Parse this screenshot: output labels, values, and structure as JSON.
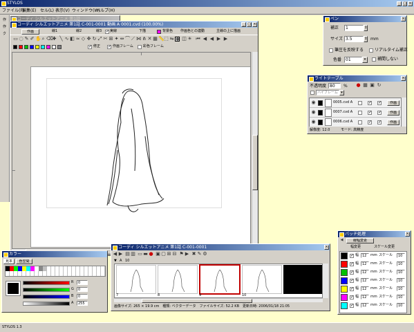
{
  "app": {
    "title": "STYLOS",
    "menu": [
      "ファイル(F)",
      "編集(E)",
      "セル(L)",
      "表示(V)",
      "ウィンドウ(W)",
      "ヘルプ(H)"
    ],
    "status": "STYLOS 1.3"
  },
  "bg_doc": {
    "title": "コーディ シルエットアニメ 第1話"
  },
  "doc": {
    "title": "コーディ シルエットアニメ 第1話 C-001-0001 動画 A 0001.cvd (100.00%)",
    "tool_row1": [
      "作画",
      "線1",
      "線2",
      "線3",
      "実線",
      "下描",
      "背景色",
      "作画色との連動",
      "主線の上に描画"
    ],
    "tool_row2": [
      "修正",
      "作画フレーム",
      "彩色フレーム"
    ],
    "colors": [
      "#000000",
      "#ff0000",
      "#00c000",
      "#0000ff",
      "#ffff00",
      "#00ffff",
      "#ff00ff",
      "#ffffff",
      "#808080"
    ]
  },
  "pen": {
    "title": "ペン",
    "hosei_label": "補正",
    "hosei_value": "1",
    "size_label": "サイズ",
    "size_value": "3.5",
    "size_unit": "mm",
    "pressure_label": "筆圧を反映する",
    "realtime_label": "リアルタイム補正",
    "color_label": "色番",
    "color_value": "01",
    "antialias_label": "補間しない"
  },
  "light": {
    "title": "ライトテーブル",
    "opacity_label": "不透明度",
    "opacity_value": "80",
    "opacity_unit": "%",
    "dropdown": "ハイフレーム",
    "rows": [
      {
        "name": "0005.cvd A",
        "tag": "作画"
      },
      {
        "name": "0007.cvd A",
        "tag": "作画"
      },
      {
        "name": "0006.cvd A",
        "tag": "作画"
      }
    ],
    "footer_res": "解像度: 12.0",
    "footer_mode": "モード: 高精度"
  },
  "color_win": {
    "title": "カラー",
    "tabs": [
      "見本",
      "色空間"
    ],
    "sliders": [
      {
        "label": "R",
        "value": "0"
      },
      {
        "label": "G",
        "value": "0"
      },
      {
        "label": "B",
        "value": "0"
      },
      {
        "label": "A",
        "value": "255"
      }
    ]
  },
  "timeline": {
    "title": "コーディ シルエットアニメ 第1話 C-001-0001",
    "layer": "A",
    "layer_count": "10",
    "frames": [
      "7",
      "8",
      "9",
      "10"
    ],
    "status": "画像サイズ: 265 × 19.9 cm　種類: ベクターデータ　ファイルサイズ: 52.2 KB　更新日時: 2006/01/18 21:05"
  },
  "batch": {
    "title": "バッチ処理",
    "tab": "線幅変更",
    "col1": "幅変更",
    "col2": "スケール変更",
    "rows": [
      {
        "color": "#000000",
        "w": "12",
        "unit": "mm",
        "scale_label": "スケール",
        "scale": "10"
      },
      {
        "color": "#ff0000",
        "w": "12",
        "unit": "mm",
        "scale_label": "スケール",
        "scale": "10"
      },
      {
        "color": "#00c000",
        "w": "12",
        "unit": "mm",
        "scale_label": "スケール",
        "scale": "10"
      },
      {
        "color": "#0000ff",
        "w": "12",
        "unit": "mm",
        "scale_label": "スケール",
        "scale": "10"
      },
      {
        "color": "#ffff00",
        "w": "12",
        "unit": "mm",
        "scale_label": "スケール",
        "scale": "10"
      },
      {
        "color": "#ff00ff",
        "w": "12",
        "unit": "mm",
        "scale_label": "スケール",
        "scale": "10"
      },
      {
        "color": "#00ffff",
        "w": "12",
        "unit": "mm",
        "scale_label": "スケール",
        "scale": "10"
      }
    ]
  }
}
